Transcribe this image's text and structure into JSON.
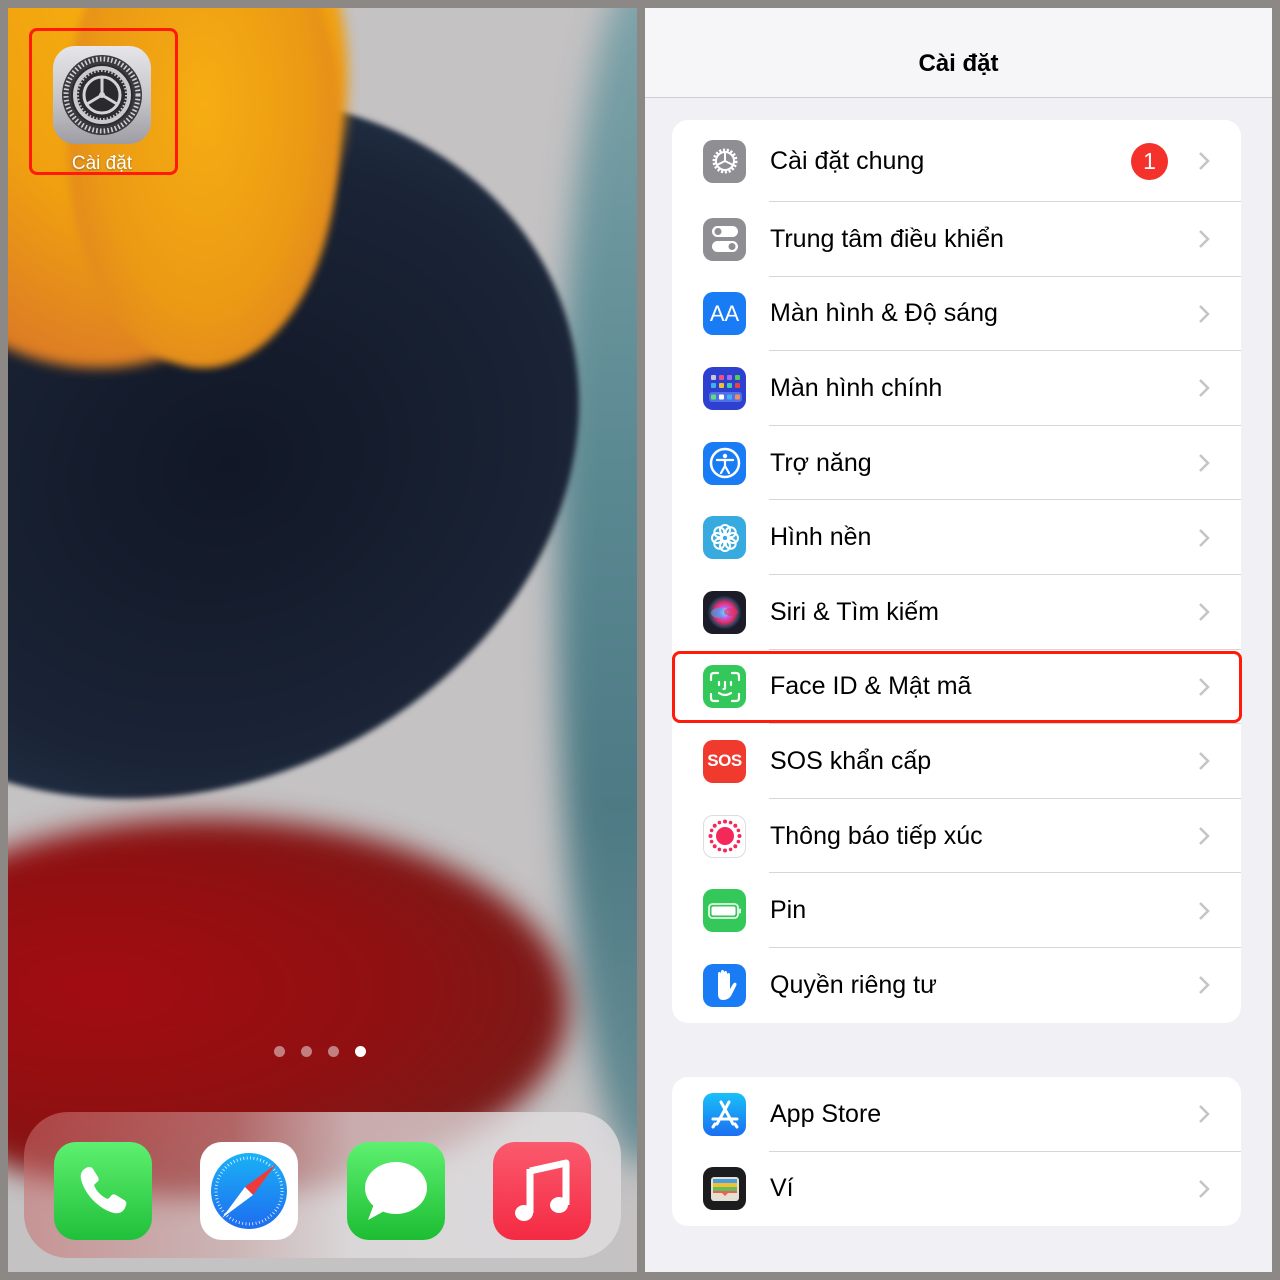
{
  "home_screen": {
    "settings_app": {
      "label": "Cài đặt",
      "icon": "settings-gear-icon"
    },
    "page_indicator": {
      "total_pages": 4,
      "current_page": 4
    },
    "dock": [
      {
        "name": "Phone",
        "icon": "phone-icon",
        "color": "#34c759"
      },
      {
        "name": "Safari",
        "icon": "safari-compass-icon",
        "color": "#1e7ff0"
      },
      {
        "name": "Messages",
        "icon": "message-bubble-icon",
        "color": "#34c759"
      },
      {
        "name": "Music",
        "icon": "music-note-icon",
        "color": "#f42a43"
      }
    ],
    "highlight_color": "#ff1a0a"
  },
  "settings_screen": {
    "title": "Cài đặt",
    "group1": [
      {
        "label": "Cài đặt chung",
        "icon": "gear-icon",
        "icon_color": "#8e8e93",
        "badge": "1"
      },
      {
        "label": "Trung tâm điều khiển",
        "icon": "toggles-icon",
        "icon_color": "#8e8e93"
      },
      {
        "label": "Màn hình & Độ sáng",
        "icon": "text-size-icon",
        "icon_color": "#1a7cf5",
        "icon_text": "AA"
      },
      {
        "label": "Màn hình chính",
        "icon": "home-grid-icon",
        "icon_color": "#2e40d0"
      },
      {
        "label": "Trợ năng",
        "icon": "accessibility-icon",
        "icon_color": "#1a7cf5"
      },
      {
        "label": "Hình nền",
        "icon": "wallpaper-flower-icon",
        "icon_color": "#37aae0"
      },
      {
        "label": "Siri & Tìm kiếm",
        "icon": "siri-icon",
        "icon_color": "#222233"
      },
      {
        "label": "Face ID & Mật mã",
        "icon": "face-id-icon",
        "icon_color": "#34c759",
        "highlighted": true
      },
      {
        "label": "SOS khẩn cấp",
        "icon": "sos-icon",
        "icon_color": "#f03a2e",
        "icon_text": "SOS"
      },
      {
        "label": "Thông báo tiếp xúc",
        "icon": "exposure-notification-icon",
        "icon_color": "#ffffff"
      },
      {
        "label": "Pin",
        "icon": "battery-icon",
        "icon_color": "#34c759"
      },
      {
        "label": "Quyền riêng tư",
        "icon": "hand-icon",
        "icon_color": "#1a7cf5"
      }
    ],
    "group2": [
      {
        "label": "App Store",
        "icon": "app-store-icon",
        "icon_color": "#1b8ef5"
      },
      {
        "label": "Ví",
        "icon": "wallet-icon",
        "icon_color": "#1c1c1e"
      }
    ],
    "highlight_color": "#ff1a0a",
    "badge_color": "#f4312b"
  }
}
